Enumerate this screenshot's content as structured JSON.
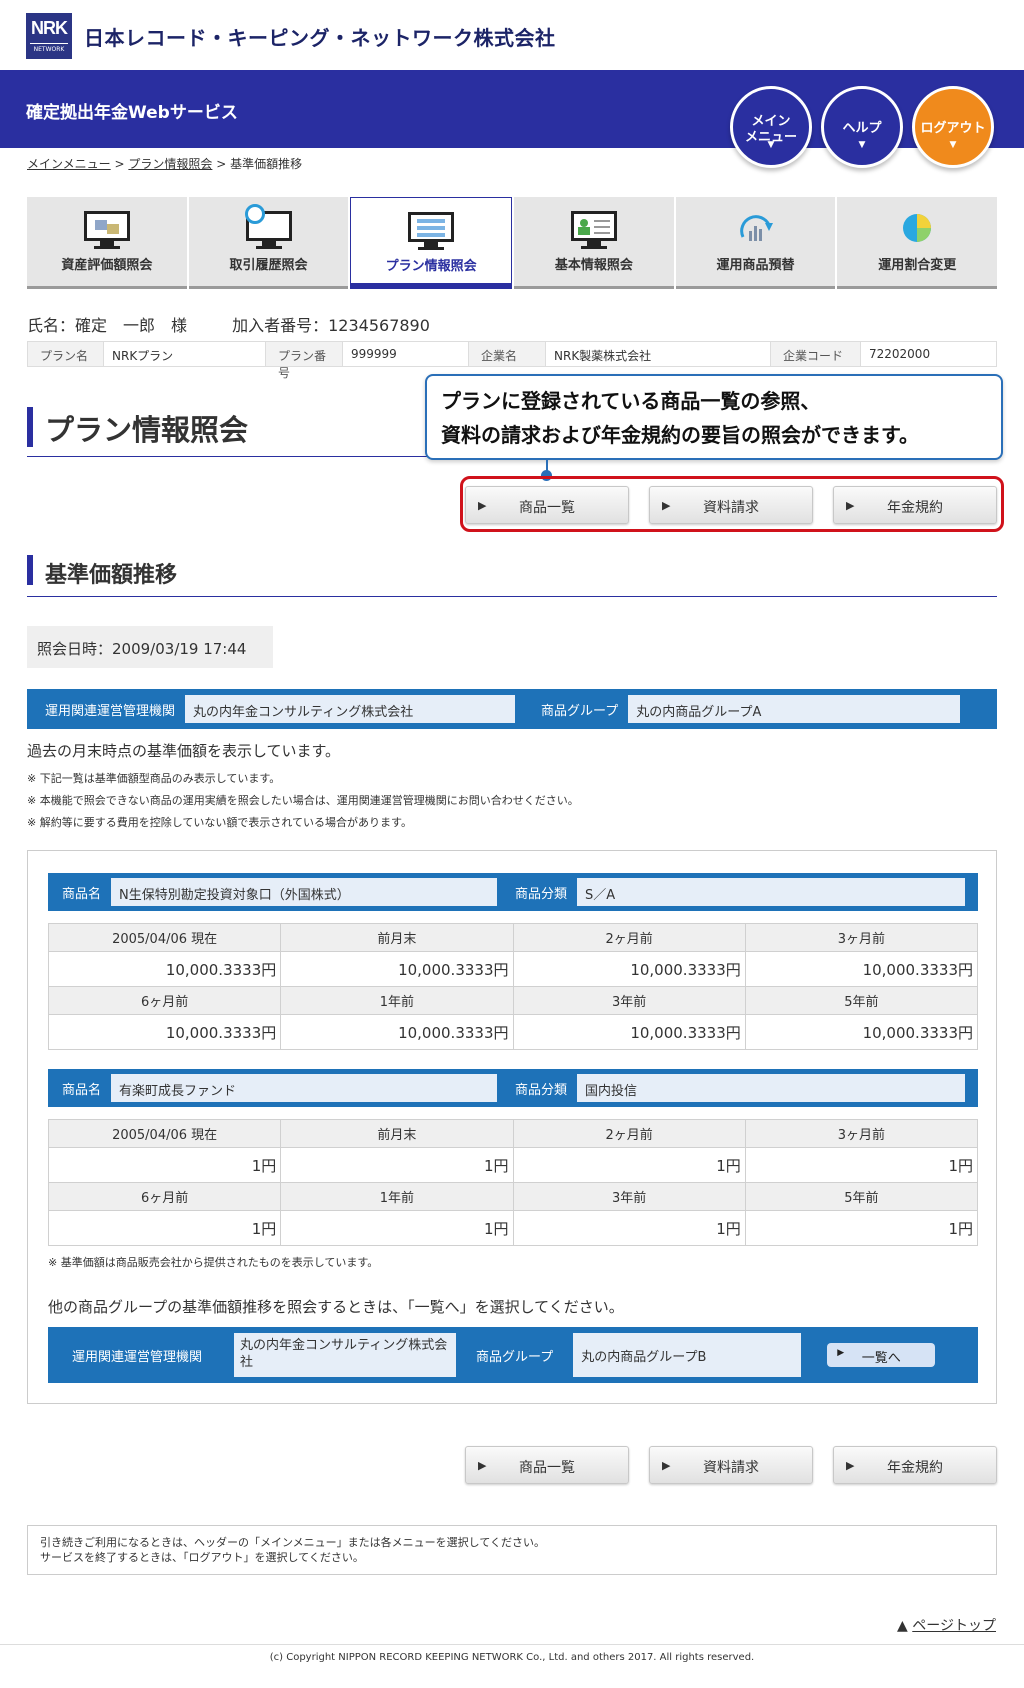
{
  "header": {
    "logo_text": "NRK",
    "logo_sub": "NETWORK",
    "company": "日本レコード・キーピング・ネットワーク株式会社",
    "service": "確定拠出年金Webサービス",
    "circles": [
      {
        "label": "メイン\nメニュー",
        "icon": "chevron-down-icon"
      },
      {
        "label": "ヘルプ",
        "icon": "chevron-down-icon"
      },
      {
        "label": "ログアウト",
        "icon": "chevron-down-icon"
      }
    ]
  },
  "breadcrumb": {
    "items": [
      "メインメニュー",
      "プラン情報照会",
      "基準価額推移"
    ],
    "sep": ">"
  },
  "tabs": [
    {
      "label": "資産評価額照会",
      "icon": "monitor-money-icon"
    },
    {
      "label": "取引履歴照会",
      "icon": "monitor-search-icon"
    },
    {
      "label": "プラン情報照会",
      "icon": "monitor-list-icon",
      "active": true
    },
    {
      "label": "基本情報照会",
      "icon": "monitor-profile-icon"
    },
    {
      "label": "運用商品預替",
      "icon": "refresh-chart-icon"
    },
    {
      "label": "運用割合変更",
      "icon": "pie-chart-icon"
    }
  ],
  "member": {
    "name": "氏名：確定　一郎　様",
    "number": "加入者番号：1234567890"
  },
  "plan": {
    "plan_name_label": "プラン名",
    "plan_name": "NRKプラン",
    "plan_no_label": "プラン番号",
    "plan_no": "999999",
    "company_label": "企業名",
    "company": "NRK製薬株式会社",
    "code_label": "企業コード",
    "code": "72202000"
  },
  "page_title": "プラン情報照会",
  "callout": {
    "line1": "プランに登録されている商品一覧の参照、",
    "line2": "資料の請求および年金規約の要旨の照会ができます。"
  },
  "buttons": {
    "list": "商品一覧",
    "docs": "資料請求",
    "rules": "年金規約"
  },
  "section_title": "基準価額推移",
  "inquiry_date": "照会日時：2009/03/19 17:44",
  "org": {
    "org_label": "運用関連運営管理機関",
    "org_value": "丸の内年金コンサルティング株式会社",
    "group_label": "商品グループ",
    "group_value": "丸の内商品グループA"
  },
  "description": "過去の月末時点の基準価額を表示しています。",
  "notes": [
    "※ 下記一覧は基準価額型商品のみ表示しています。",
    "※ 本機能で照会できない商品の運用実績を照会したい場合は、運用関連運営管理機関にお問い合わせください。",
    "※ 解約等に要する費用を控除していない額で表示されている場合があります。"
  ],
  "products": [
    {
      "name_label": "商品名",
      "name": "N生保特別勘定投資対象口（外国株式）",
      "cat_label": "商品分類",
      "cat": "S／A",
      "headers1": [
        "2005/04/06 現在",
        "前月末",
        "2ヶ月前",
        "3ヶ月前"
      ],
      "values1": [
        "10,000.3333円",
        "10,000.3333円",
        "10,000.3333円",
        "10,000.3333円"
      ],
      "headers2": [
        "6ヶ月前",
        "1年前",
        "3年前",
        "5年前"
      ],
      "values2": [
        "10,000.3333円",
        "10,000.3333円",
        "10,000.3333円",
        "10,000.3333円"
      ]
    },
    {
      "name_label": "商品名",
      "name": "有楽町成長ファンド",
      "cat_label": "商品分類",
      "cat": "国内投信",
      "headers1": [
        "2005/04/06 現在",
        "前月末",
        "2ヶ月前",
        "3ヶ月前"
      ],
      "values1": [
        "1円",
        "1円",
        "1円",
        "1円"
      ],
      "headers2": [
        "6ヶ月前",
        "1年前",
        "3年前",
        "5年前"
      ],
      "values2": [
        "1円",
        "1円",
        "1円",
        "1円"
      ]
    }
  ],
  "price_note": "※ 基準価額は商品販売会社から提供されたものを表示しています。",
  "other_group_note": "他の商品グループの基準価額推移を照会するときは、「一覧へ」を選択してください。",
  "other": {
    "org_label": "運用関連運営管理機関",
    "org_value": "丸の内年金コンサルティング株式会社",
    "group_label": "商品グループ",
    "group_value": "丸の内商品グループB",
    "button": "一覧へ"
  },
  "footer": {
    "line1": "引き続きご利用になるときは、ヘッダーの「メインメニュー」または各メニューを選択してください。",
    "line2": "サービスを終了するときは、「ログアウト」を選択してください。",
    "pagetop": "ページトップ",
    "copyright": "(c) Copyright NIPPON RECORD KEEPING NETWORK Co., Ltd. and others 2017. All rights reserved."
  }
}
